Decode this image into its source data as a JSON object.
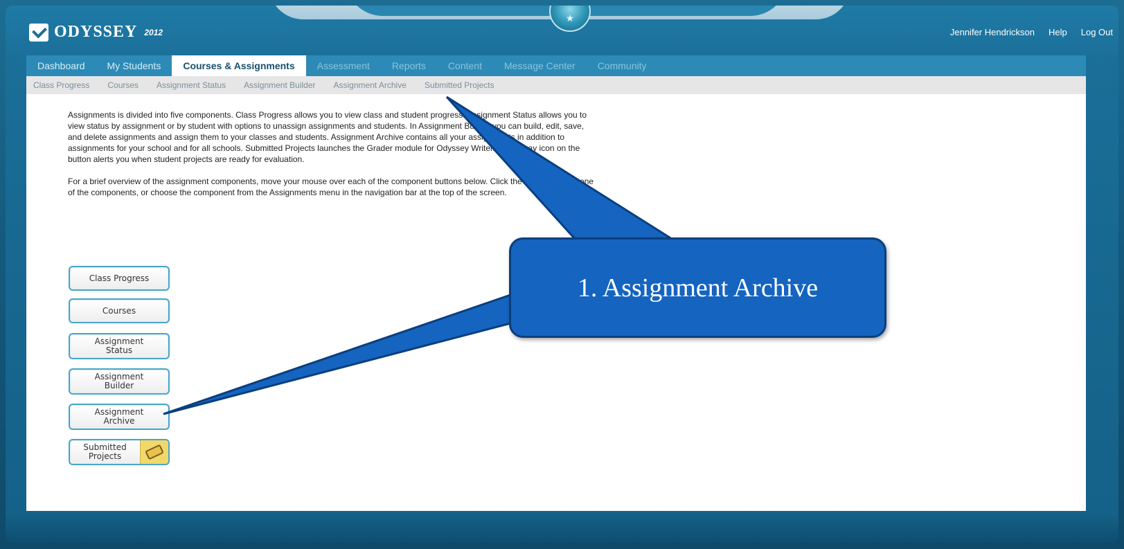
{
  "app": {
    "logo_text": "ODYSSEY",
    "logo_year": "2012"
  },
  "user_links": {
    "user_name": "Jennifer Hendrickson",
    "help": "Help",
    "logout": "Log Out"
  },
  "main_nav": {
    "tabs": [
      {
        "label": "Dashboard"
      },
      {
        "label": "My Students"
      },
      {
        "label": "Courses & Assignments"
      },
      {
        "label": "Assessment"
      },
      {
        "label": "Reports"
      },
      {
        "label": "Content"
      },
      {
        "label": "Message Center"
      },
      {
        "label": "Community"
      }
    ],
    "active": "Courses & Assignments"
  },
  "sub_nav": {
    "items": [
      {
        "label": "Class Progress"
      },
      {
        "label": "Courses"
      },
      {
        "label": "Assignment Status"
      },
      {
        "label": "Assignment Builder"
      },
      {
        "label": "Assignment Archive"
      },
      {
        "label": "Submitted Projects"
      }
    ]
  },
  "content": {
    "paragraph1": "Assignments is divided into five components. Class Progress allows you to view class and student progress. Assignment Status allows you to view status by assignment or by student with options to unassign assignments and students. In Assignment Builder you can build, edit, save, and delete assignments and assign them to your classes and students. Assignment Archive contains all your assignments in addition to assignments for your school and for all schools. Submitted Projects launches the Grader module for Odyssey Writer. The in-tray icon on the button alerts you when student projects are ready for evaluation.",
    "paragraph2": "For a brief overview of the assignment components, move your mouse over each of the component buttons below. Click the button to go to one of the components, or choose the component from the Assignments menu in the navigation bar at the top of the screen."
  },
  "component_buttons": {
    "class_progress": "Class Progress",
    "courses": "Courses",
    "assignment_status_1": "Assignment",
    "assignment_status_2": "Status",
    "assignment_builder_1": "Assignment",
    "assignment_builder_2": "Builder",
    "assignment_archive_1": "Assignment",
    "assignment_archive_2": "Archive",
    "submitted_projects_1": "Submitted",
    "submitted_projects_2": "Projects"
  },
  "callout": {
    "text": "1. Assignment Archive",
    "color": "#1564c0"
  },
  "icons": {
    "logo": "checkmark-logo-icon",
    "globe": "globe-icon",
    "tray": "in-tray-icon"
  }
}
